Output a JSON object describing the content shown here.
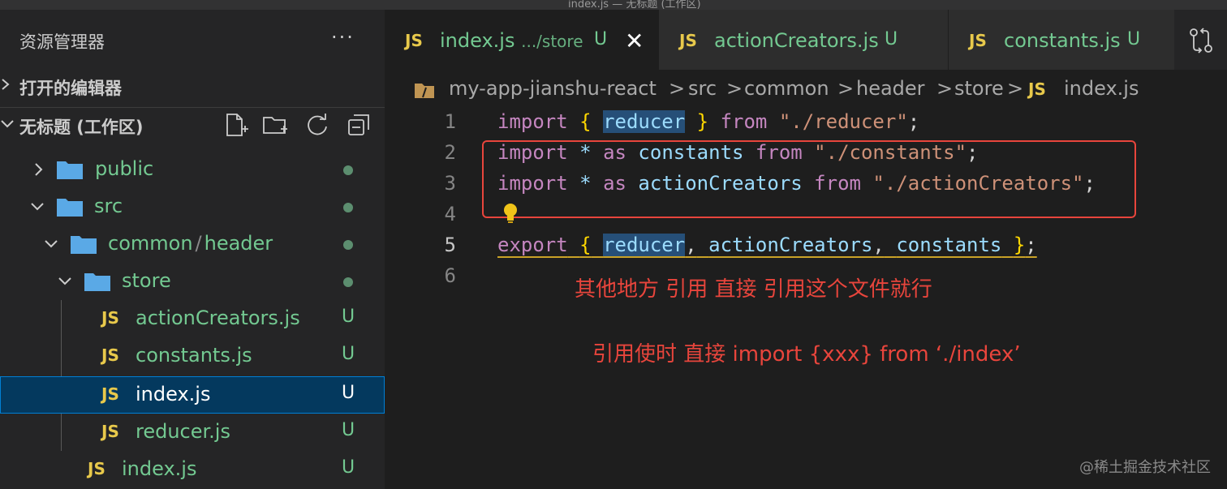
{
  "window": {
    "title": "index.js — 无标题 (工作区)"
  },
  "sidebar": {
    "title": "资源管理器",
    "more": "···",
    "sections": {
      "open_editors": "打开的编辑器",
      "workspace": "无标题 (工作区)"
    },
    "tree": [
      {
        "name": "public",
        "type": "folder",
        "expanded": false,
        "status": "dot"
      },
      {
        "name": "src",
        "type": "folder",
        "expanded": true,
        "status": "dot"
      },
      {
        "name_a": "common",
        "name_b": "header",
        "type": "folder",
        "expanded": true,
        "status": "dot"
      },
      {
        "name": "store",
        "type": "folder",
        "expanded": true,
        "status": "dot"
      },
      {
        "name": "actionCreators.js",
        "type": "file",
        "icon": "JS",
        "status": "U"
      },
      {
        "name": "constants.js",
        "type": "file",
        "icon": "JS",
        "status": "U"
      },
      {
        "name": "index.js",
        "type": "file",
        "icon": "JS",
        "status": "U",
        "selected": true
      },
      {
        "name": "reducer.js",
        "type": "file",
        "icon": "JS",
        "status": "U"
      },
      {
        "name": "index.js",
        "type": "file",
        "icon": "JS",
        "status": "U"
      }
    ]
  },
  "tabs": [
    {
      "icon": "JS",
      "name": "index.js",
      "desc": ".../store",
      "status": "U",
      "close": "✕",
      "active": true
    },
    {
      "icon": "JS",
      "name": "actionCreators.js",
      "status": "U"
    },
    {
      "icon": "JS",
      "name": "constants.js",
      "status": "U"
    }
  ],
  "breadcrumb": [
    "my-app-jianshu-react",
    "src",
    "common",
    "header",
    "store",
    "index.js"
  ],
  "breadcrumb_file_icon": "JS",
  "breadcrumb_sep": ">",
  "code": {
    "line_numbers": [
      "1",
      "2",
      "3",
      "4",
      "5",
      "6"
    ],
    "l1": {
      "k1": "import",
      "b1": "{",
      "v1": "reducer",
      "b2": "}",
      "k2": "from",
      "s": "\"./reducer\"",
      "end": ";"
    },
    "l2": {
      "k1": "import",
      "op": "*",
      "k2": "as",
      "v": "constants",
      "k3": "from",
      "s": "\"./constants\"",
      "end": ";"
    },
    "l3": {
      "k1": "import",
      "op": "*",
      "k2": "as",
      "v": "actionCreators",
      "k3": "from",
      "s": "\"./actionCreators\"",
      "end": ";"
    },
    "l5": {
      "k1": "export",
      "b1": "{",
      "v1": "reducer",
      "c1": ",",
      "v2": "actionCreators",
      "c2": ",",
      "v3": "constants",
      "b2": "}",
      "end": ";"
    }
  },
  "annotations": {
    "note1": "其他地方 引用 直接 引用这个文件就行",
    "note2": "引用使时 直接 import {xxx} from ‘./index’",
    "color": "#e8453c"
  },
  "watermark": "@稀土掘金技术社区",
  "colors": {
    "untracked": "#73c991",
    "js_icon": "#e8c94b",
    "folder": "#5aa9e6",
    "selection": "#04395e"
  }
}
